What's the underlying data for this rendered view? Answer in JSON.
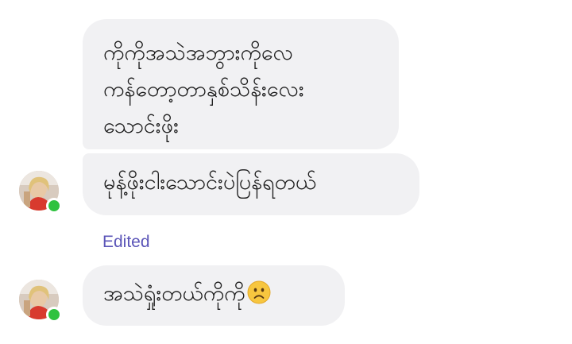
{
  "messages": [
    {
      "lines": [
        "ကိုကိုအသဲအဘွားကိုလေ",
        "ကန်တော့တာနှစ်သိန်းလေး",
        "သောင်းဖိုး"
      ]
    },
    {
      "text": "မုန့်ဖိုးငါးသောင်းပဲပြန်ရတယ်"
    },
    {
      "status": "Edited",
      "text": "အသဲရှုံးတယ်ကိုကို",
      "emoji": "frowning-face-emoji"
    }
  ],
  "colors": {
    "bubble": "#f1f1f3",
    "edited": "#5b55b8",
    "online": "#2fc23f"
  },
  "icons": {
    "avatar": "avatar",
    "online": "online-dot"
  }
}
